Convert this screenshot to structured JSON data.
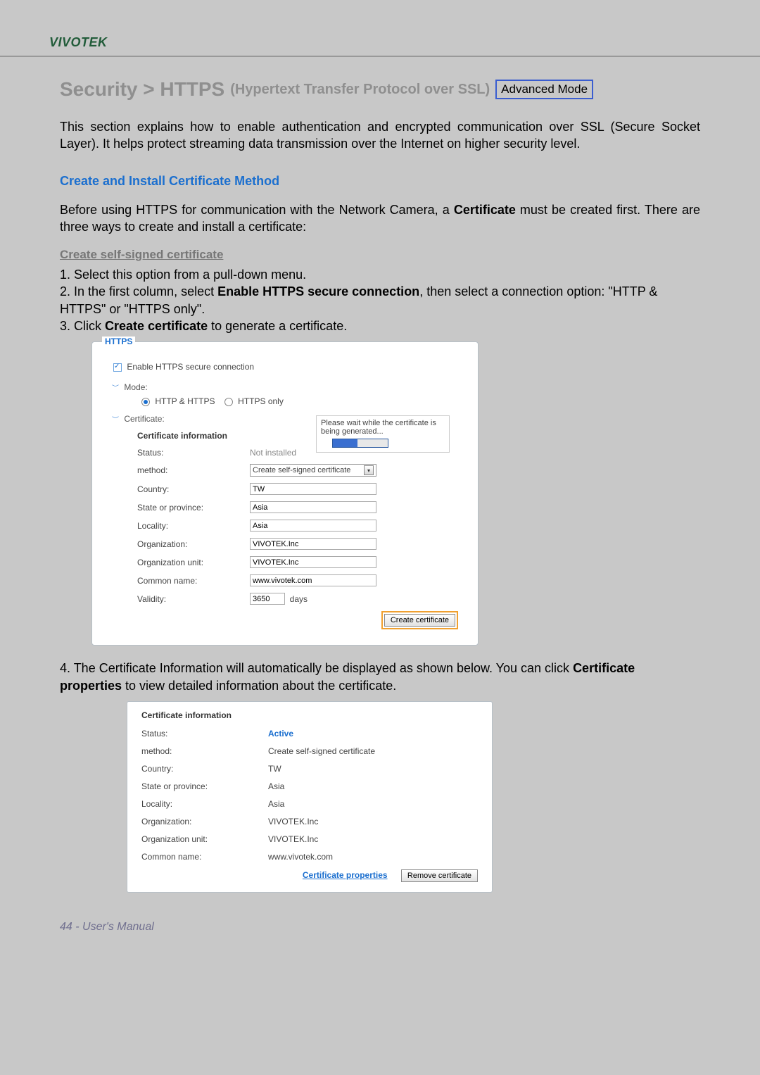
{
  "header": {
    "brand": "VIVOTEK"
  },
  "title": {
    "main": "Security >  HTTPS",
    "sub": "(Hypertext Transfer Protocol over SSL)",
    "badge": "Advanced Mode"
  },
  "intro": "This section explains how to enable authentication and encrypted communication over SSL (Secure Socket Layer). It helps protect streaming data transmission over the Internet on higher security level.",
  "section1_heading": "Create and Install Certificate Method",
  "section1_intro_a": "Before using HTTPS for communication with the Network Camera, a ",
  "section1_intro_b": "Certificate",
  "section1_intro_c": " must be created first. There are three ways to create and install a certificate:",
  "self_signed_heading": "Create self-signed certificate",
  "steps": {
    "s1": "1. Select this option from a pull-down menu.",
    "s2a": "2. In the first column, select ",
    "s2b": "Enable HTTPS secure connection",
    "s2c": ", then select a connection option: \"HTTP & HTTPS\" or \"HTTPS only\".",
    "s3a": "3. Click ",
    "s3b": "Create certificate",
    "s3c": " to generate a certificate."
  },
  "panel1": {
    "fieldset": "HTTPS",
    "enable_label": "Enable HTTPS secure connection",
    "mode_label": "Mode:",
    "radio_http_https": "HTTP & HTTPS",
    "radio_https_only": "HTTPS only",
    "cert_label": "Certificate:",
    "wait_msg": "Please wait while the certificate is being generated...",
    "cert_info_heading": "Certificate information",
    "labels": {
      "status": "Status:",
      "method": "method:",
      "country": "Country:",
      "state": "State or province:",
      "locality": "Locality:",
      "org": "Organization:",
      "org_unit": "Organization unit:",
      "common_name": "Common name:",
      "validity": "Validity:"
    },
    "values": {
      "status": "Not installed",
      "method": "Create self-signed certificate",
      "country": "TW",
      "state": "Asia",
      "locality": "Asia",
      "org": "VIVOTEK.Inc",
      "org_unit": "VIVOTEK.Inc",
      "common_name": "www.vivotek.com",
      "validity": "3650",
      "validity_unit": "days"
    },
    "create_btn": "Create certificate"
  },
  "step4": {
    "a": "4. The Certificate Information will automatically be displayed as shown below. You can click ",
    "b": "Certificate properties",
    "c": " to view detailed information about the certificate."
  },
  "panel2": {
    "heading": "Certificate information",
    "labels": {
      "status": "Status:",
      "method": "method:",
      "country": "Country:",
      "state": "State or province:",
      "locality": "Locality:",
      "org": "Organization:",
      "org_unit": "Organization unit:",
      "common_name": "Common name:"
    },
    "values": {
      "status": "Active",
      "method": "Create self-signed certificate",
      "country": "TW",
      "state": "Asia",
      "locality": "Asia",
      "org": "VIVOTEK.Inc",
      "org_unit": "VIVOTEK.Inc",
      "common_name": "www.vivotek.com"
    },
    "link": "Certificate properties",
    "remove_btn": "Remove certificate"
  },
  "footer": "44 - User's Manual"
}
